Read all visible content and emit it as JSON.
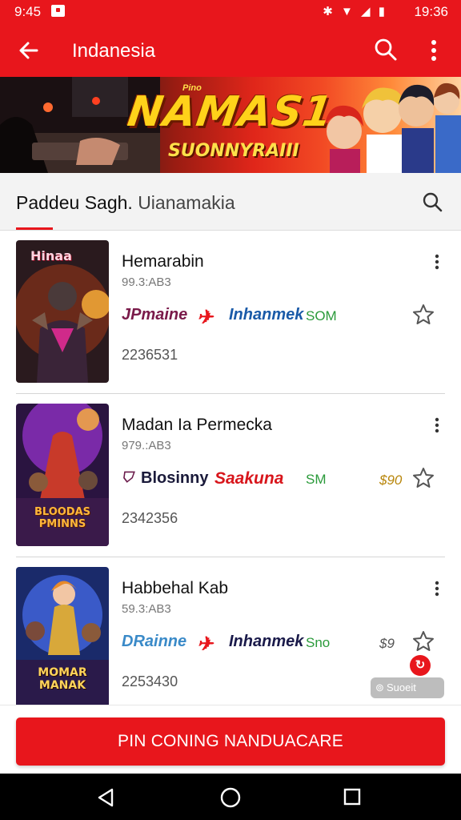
{
  "status_bar": {
    "time": "9:45",
    "clock": "19:36",
    "icons": "✱ ▼ ◢ ▮"
  },
  "app_bar": {
    "title": "Indanesia"
  },
  "banner": {
    "tag": "Pino",
    "title": "NAMAS1",
    "subtitle": "SUONNYRAIII"
  },
  "section": {
    "title": "Paddeu Sagh.",
    "subtitle": "Uianamakia"
  },
  "items": [
    {
      "name": "Hemarabin",
      "meta": "99.3:AB3",
      "brand1": "JPmaine",
      "brand2": "Inhanmek",
      "brand3": "SOM",
      "extra": "",
      "count": "2236531",
      "thumb_title": "Hinaa",
      "thumb_caption": ""
    },
    {
      "name": "Madan Ia Permecka",
      "meta": "979.:AB3",
      "brand1": "Blosinny",
      "brand2": "Saakuna",
      "brand3": "SM",
      "extra": "$90",
      "count": "2342356",
      "thumb_title": "",
      "thumb_caption": "BLOODAS PMINNS"
    },
    {
      "name": "Habbehal Kab",
      "meta": "59.3:AB3",
      "brand1": "DRainne",
      "brand2": "Inhanmek",
      "brand3": "Sno",
      "extra": "$9",
      "count": "2253430",
      "thumb_title": "",
      "thumb_caption": "MOMAR MANAK"
    }
  ],
  "fab": {
    "badge": "Suoeit"
  },
  "cta": {
    "label": "PIN CONING NANDUACARE"
  },
  "colors": {
    "accent": "#e8161c",
    "bg": "#ffffff"
  }
}
